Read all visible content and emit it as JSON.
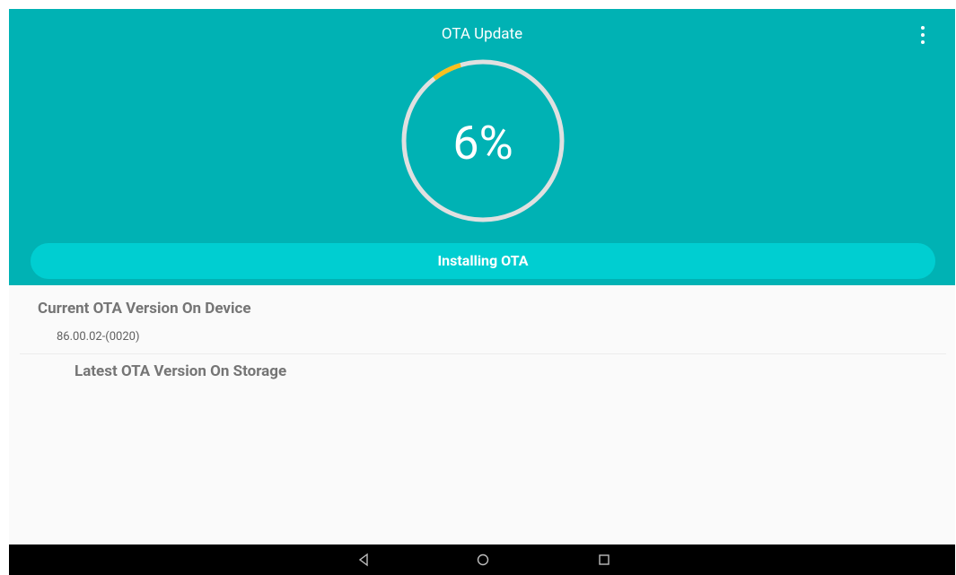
{
  "app": {
    "title": "OTA Update"
  },
  "progress": {
    "percent": 6,
    "label": "6%",
    "arc_color": "#f9c01e",
    "track_color": "#e0e0e0"
  },
  "status": {
    "label": "Installing OTA"
  },
  "info": {
    "current_label": "Current OTA Version On Device",
    "current_value": "86.00.02-(0020)",
    "latest_label": "Latest OTA Version On Storage"
  },
  "colors": {
    "header": "#00b2b4",
    "status_pill": "#00ced1",
    "background": "#fafafa"
  },
  "icons": {
    "menu": "more-vert-icon",
    "back": "back-icon",
    "home": "home-icon",
    "recents": "recents-icon"
  }
}
